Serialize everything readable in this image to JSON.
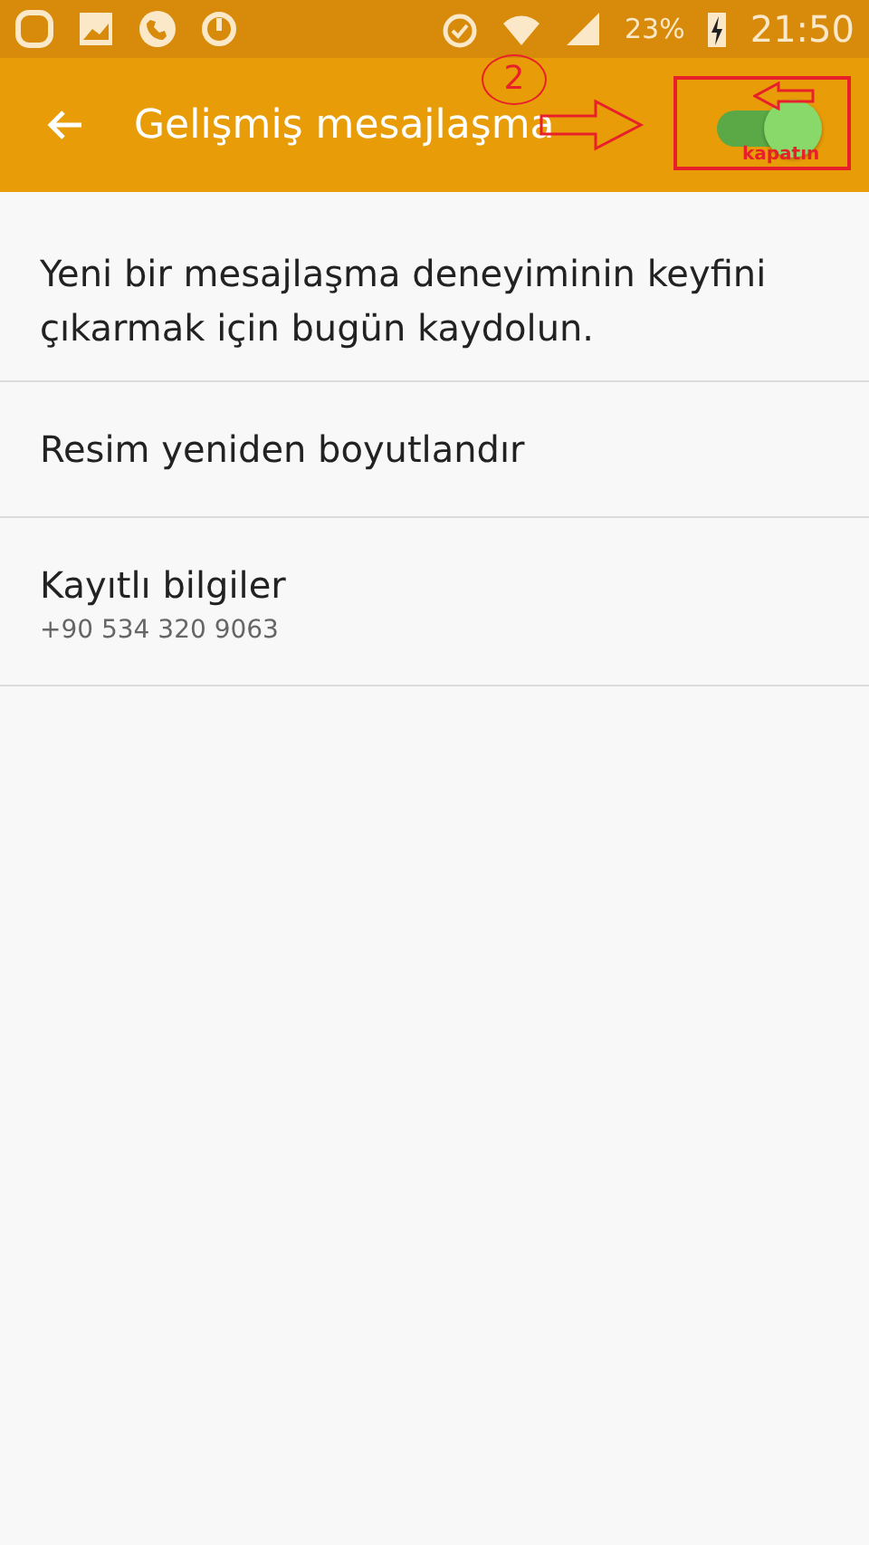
{
  "status_bar": {
    "battery": "23%",
    "time": "21:50"
  },
  "app_bar": {
    "title": "Gelişmiş mesajlaşma",
    "toggle": {
      "on": true
    }
  },
  "annotation": {
    "step": "2",
    "label": "kapatın"
  },
  "items": [
    {
      "kind": "text",
      "title": "Yeni bir mesajlaşma deneyiminin keyfini çıkarmak için bugün kaydolun."
    },
    {
      "kind": "setting",
      "title": "Resim yeniden boyutlandır"
    },
    {
      "kind": "setting",
      "title": "Kayıtlı bilgiler",
      "subtitle": "+90 534 320 9063"
    }
  ]
}
